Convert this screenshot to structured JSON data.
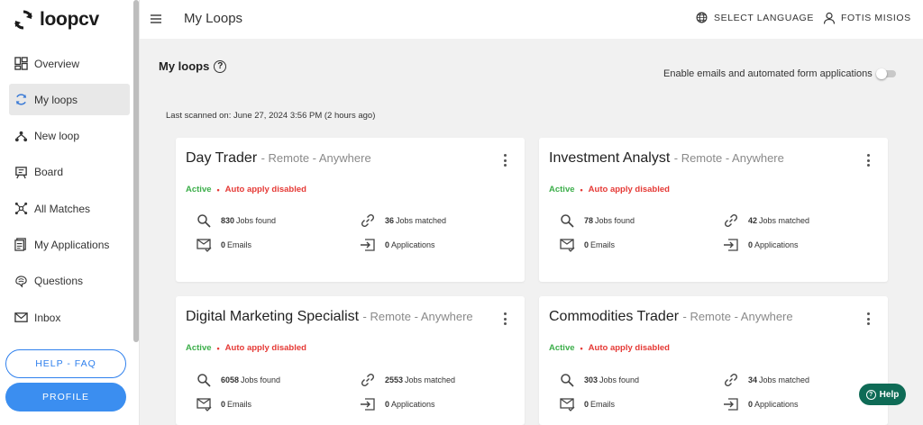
{
  "app": {
    "logo_text": "loopcv"
  },
  "sidebar": {
    "items": [
      {
        "label": "Overview",
        "icon": "dashboard-icon"
      },
      {
        "label": "My loops",
        "icon": "loop-icon"
      },
      {
        "label": "New loop",
        "icon": "new-loop-icon"
      },
      {
        "label": "Board",
        "icon": "board-icon"
      },
      {
        "label": "All Matches",
        "icon": "matches-icon"
      },
      {
        "label": "My Applications",
        "icon": "applications-icon"
      },
      {
        "label": "Questions",
        "icon": "questions-icon"
      },
      {
        "label": "Inbox",
        "icon": "mail-icon"
      }
    ],
    "help_label": "HELP - FAQ",
    "profile_label": "PROFILE"
  },
  "topbar": {
    "title": "My Loops",
    "language_label": "SELECT LANGUAGE",
    "user_label": "FOTIS MISIOS"
  },
  "main": {
    "section_title": "My loops",
    "section_help_glyph": "?",
    "toggle_label": "Enable emails and automated form applications",
    "toggle_on": false,
    "last_scanned": "Last scanned on: June 27, 2024 3:56 PM (2 hours ago)"
  },
  "loops": [
    {
      "title": "Day Trader",
      "location": "- Remote - Anywhere",
      "status": "Active",
      "separator": "•",
      "auto": "Auto apply disabled",
      "jobs_found": "830",
      "jobs_found_label": "Jobs found",
      "jobs_matched": "36",
      "jobs_matched_label": "Jobs matched",
      "emails": "0",
      "emails_label": "Emails",
      "applications": "0",
      "applications_label": "Applications"
    },
    {
      "title": "Investment Analyst",
      "location": "- Remote - Anywhere",
      "status": "Active",
      "separator": "•",
      "auto": "Auto apply disabled",
      "jobs_found": "78",
      "jobs_found_label": "Jobs found",
      "jobs_matched": "42",
      "jobs_matched_label": "Jobs matched",
      "emails": "0",
      "emails_label": "Emails",
      "applications": "0",
      "applications_label": "Applications"
    },
    {
      "title": "Digital Marketing Specialist",
      "location": "- Remote - Anywhere",
      "status": "Active",
      "separator": "•",
      "auto": "Auto apply disabled",
      "jobs_found": "6058",
      "jobs_found_label": "Jobs found",
      "jobs_matched": "2553",
      "jobs_matched_label": "Jobs matched",
      "emails": "0",
      "emails_label": "Emails",
      "applications": "0",
      "applications_label": "Applications"
    },
    {
      "title": "Commodities Trader",
      "location": "- Remote - Anywhere",
      "status": "Active",
      "separator": "•",
      "auto": "Auto apply disabled",
      "jobs_found": "303",
      "jobs_found_label": "Jobs found",
      "jobs_matched": "34",
      "jobs_matched_label": "Jobs matched",
      "emails": "0",
      "emails_label": "Emails",
      "applications": "0",
      "applications_label": "Applications"
    }
  ],
  "help_widget": {
    "label": "Help"
  },
  "colors": {
    "accent": "#3b8ef0",
    "active_green": "#3cae4a",
    "warning_red": "#e53935",
    "help_bubble": "#0f6b56"
  }
}
